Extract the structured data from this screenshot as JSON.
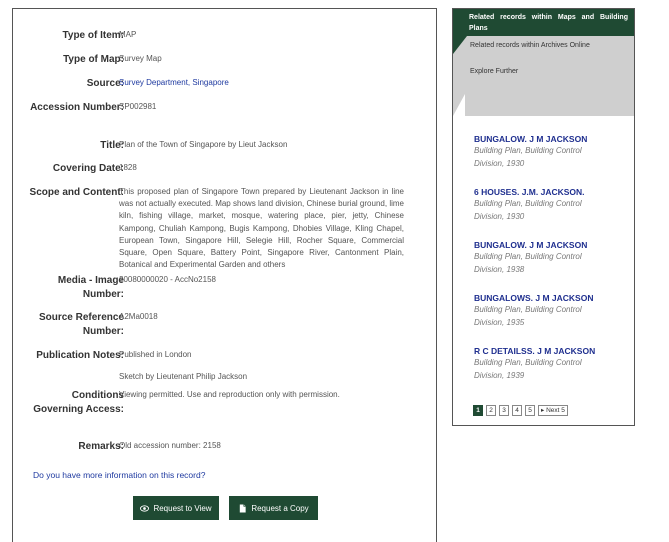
{
  "record": {
    "fields": [
      {
        "label": "Type of Item:",
        "value": "MAP"
      },
      {
        "label": "Type of Map:",
        "value": "Survey Map"
      },
      {
        "label": "Source:",
        "value": "Survey Department, Singapore"
      },
      {
        "label": "Accession Number:",
        "value": "SP002981"
      },
      {
        "label": "Title:",
        "value": "Plan of the Town of Singapore by Lieut Jackson"
      },
      {
        "label": "Covering Date:",
        "value": "1828"
      },
      {
        "label": "Scope and Content:",
        "value": "This proposed plan of Singapore Town prepared by Lieutenant Jackson in line was not actually executed. Map shows land division, Chinese burial ground, lime kiln, fishing village, market, mosque, watering place, pier, jetty, Chinese Kampong, Chuliah Kampong, Bugis Kampong, Dhobies Village, Kling Chapel, European Town, Singapore Hill, Selegie Hill, Rocher Square, Commercial Square, Open Square, Battery Point, Singapore River, Cantonment Plain, Botanical and Experimental Garden and others"
      },
      {
        "label": "Media - Image Number:",
        "value": "20080000020 - AccNo2158"
      },
      {
        "label": "Source Reference Number:",
        "value": "A2Ma0018"
      },
      {
        "label": "Publication Notes:",
        "value": "Published in London",
        "value2": "Sketch by Lieutenant Philip Jackson"
      },
      {
        "label": "Conditions Governing Access:",
        "value": "Viewing permitted. Use and reproduction only with permission."
      },
      {
        "label": "Remarks:",
        "value": "Old accession number: 2158"
      }
    ],
    "more_info_link": "Do you have more information on this record?",
    "request_view_label": "Request to View",
    "request_copy_label": "Request a Copy"
  },
  "sidebar": {
    "header": "Related records within Maps and Building Plans",
    "link_archives": "Related records within Archives Online",
    "link_explore": "Explore Further",
    "items": [
      {
        "title": "BUNGALOW. J M JACKSON",
        "sub1": "Building Plan, Building Control",
        "sub2": "Division, 1930"
      },
      {
        "title": "6 HOUSES. J.M. JACKSON.",
        "sub1": "Building Plan, Building Control",
        "sub2": "Division, 1930"
      },
      {
        "title": "BUNGALOW. J M JACKSON",
        "sub1": "Building Plan, Building Control",
        "sub2": "Division, 1938"
      },
      {
        "title": "BUNGALOWS. J M JACKSON",
        "sub1": "Building Plan, Building Control",
        "sub2": "Division, 1935"
      },
      {
        "title": "R C DETAILSS. J M JACKSON",
        "sub1": "Building Plan, Building Control",
        "sub2": "Division, 1939"
      }
    ],
    "pager": [
      "1",
      "2",
      "3",
      "4",
      "5",
      "▸ Next 5"
    ]
  },
  "colors": {
    "accent": "#1f4a33",
    "link": "#1f3aa0",
    "sidebar_gray": "#cfcfcf"
  }
}
